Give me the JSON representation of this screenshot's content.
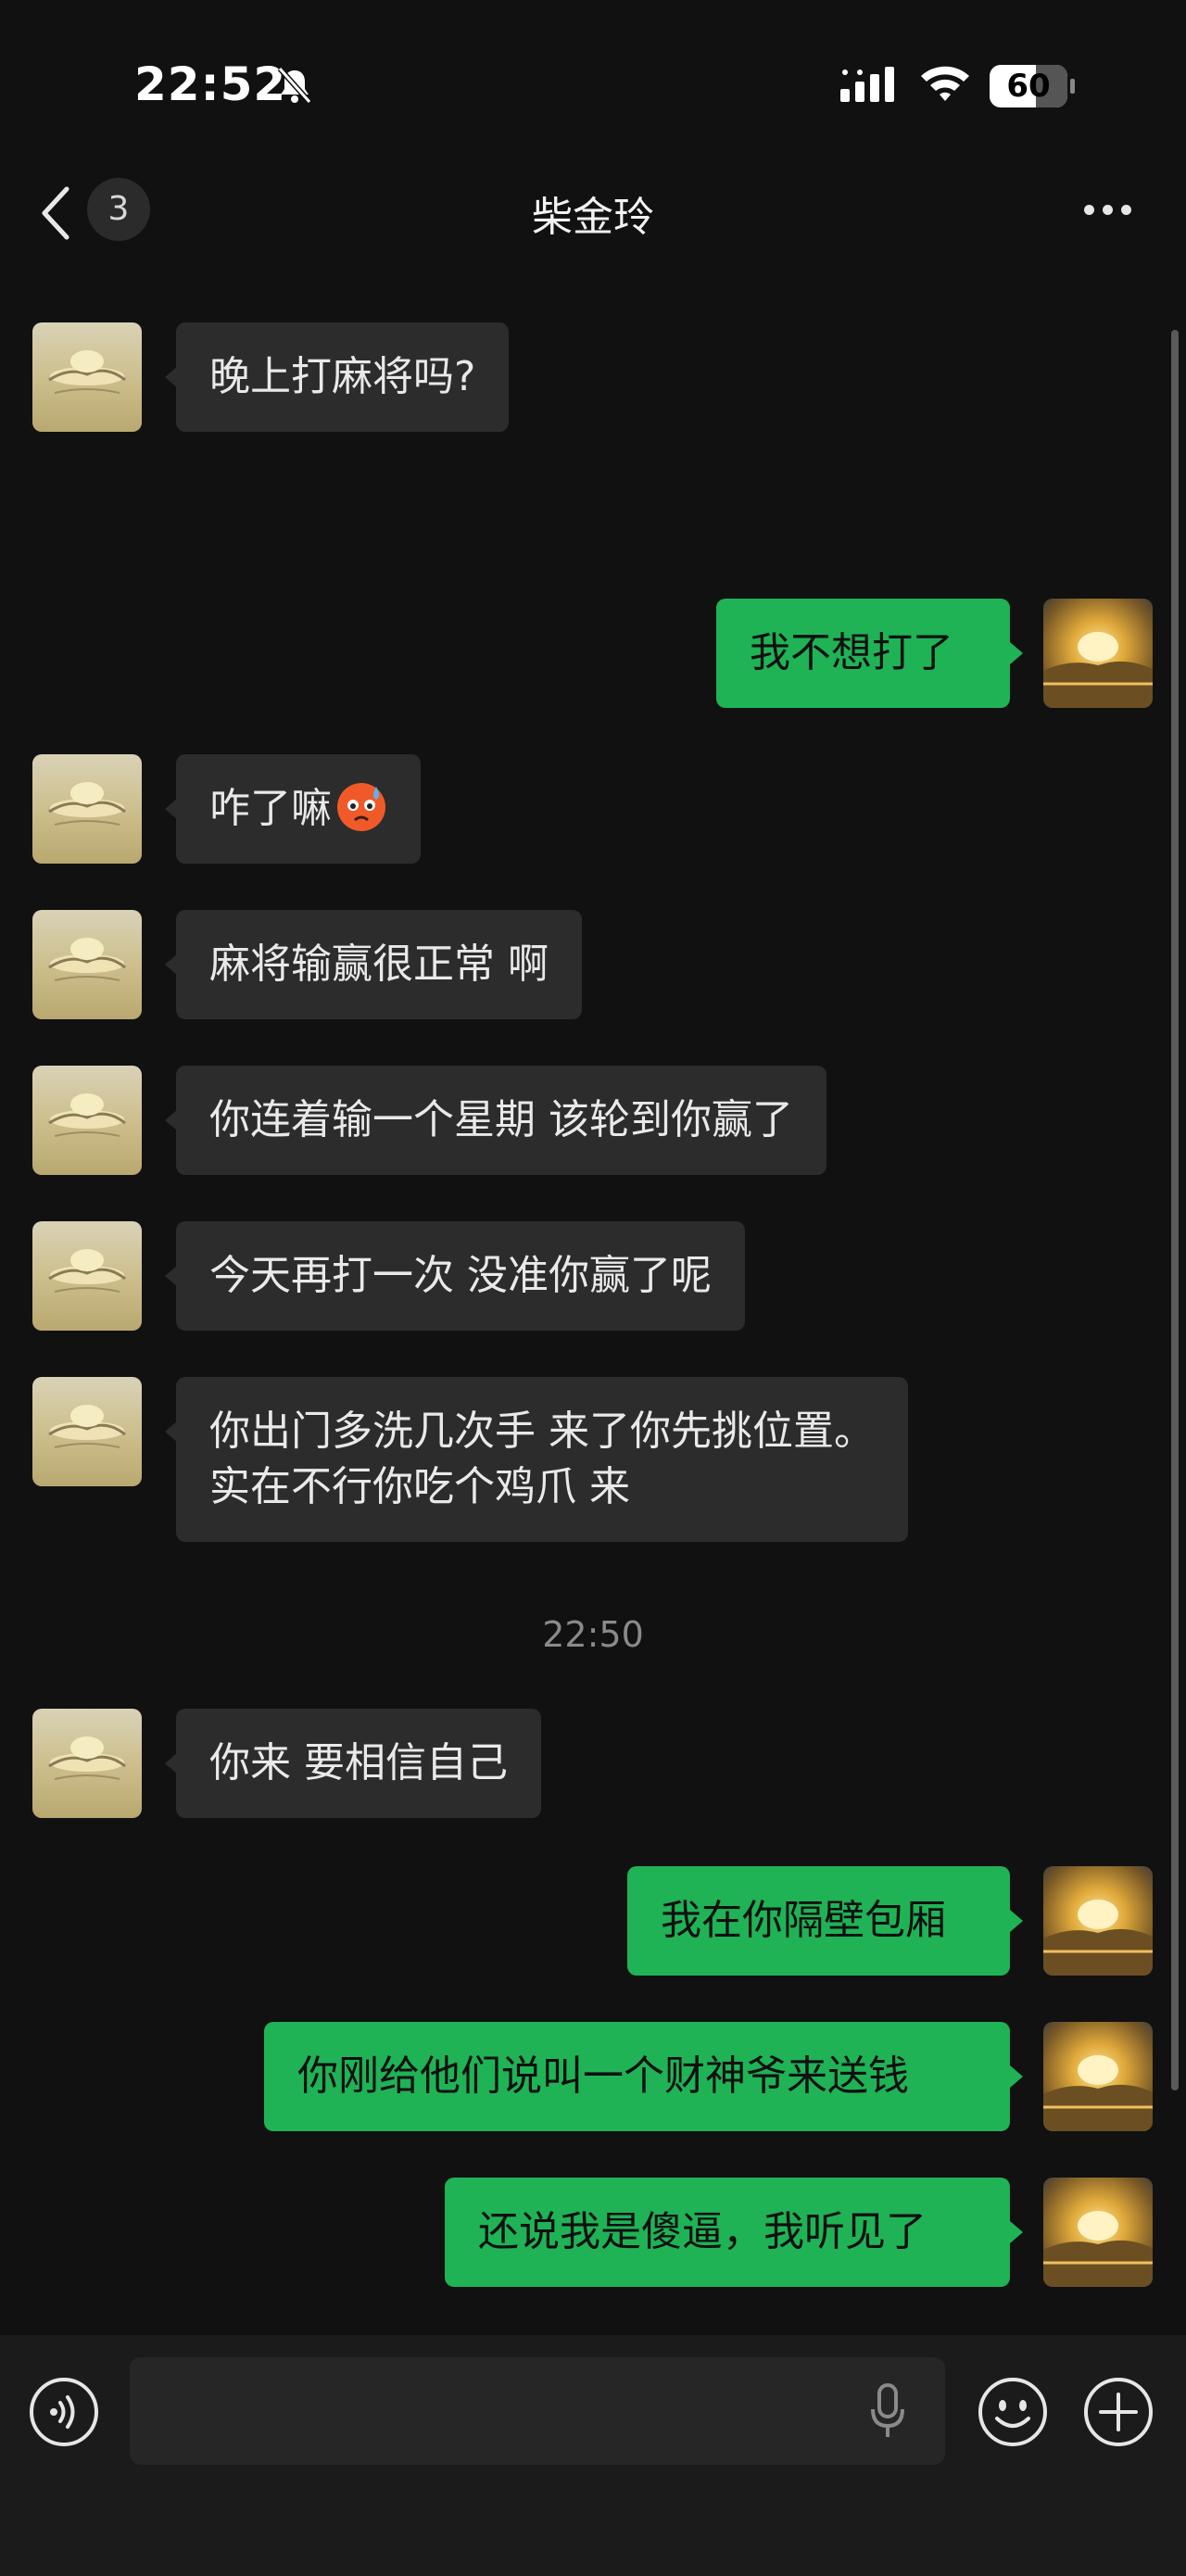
{
  "status_bar": {
    "time": "22:52",
    "battery_level": "60",
    "battery_fraction": 0.6
  },
  "header": {
    "back_unread_count": "3",
    "title": "柴金玲"
  },
  "messages": [
    {
      "side": "in",
      "lines": [
        "晚上打麻将吗?"
      ]
    },
    {
      "side": "out",
      "lines": [
        "我不想打了"
      ]
    },
    {
      "side": "in",
      "lines": [
        "咋了嘛"
      ],
      "emoji": "anxious-sweat-face"
    },
    {
      "side": "in",
      "lines": [
        "麻将输赢很正常 啊"
      ]
    },
    {
      "side": "in",
      "lines": [
        "你连着输一个星期 该轮到你赢了"
      ]
    },
    {
      "side": "in",
      "lines": [
        "今天再打一次 没准你赢了呢"
      ]
    },
    {
      "side": "in",
      "lines": [
        "你出门多洗几次手  来了你先挑位置。",
        "实在不行你吃个鸡爪 来"
      ]
    },
    {
      "side": "in",
      "lines": [
        "你来 要相信自己"
      ]
    },
    {
      "side": "out",
      "lines": [
        "我在你隔壁包厢"
      ]
    },
    {
      "side": "out",
      "lines": [
        "你刚给他们说叫一个财神爷来送钱"
      ]
    },
    {
      "side": "out",
      "lines": [
        "还说我是傻逼，我听见了"
      ]
    }
  ],
  "time_divider": "22:50",
  "input_bar": {
    "placeholder": ""
  },
  "colors": {
    "background": "#111111",
    "incoming_bubble": "#2c2c2c",
    "outgoing_bubble": "#1fb356",
    "input_bar": "#1b1b1b"
  },
  "icons": {
    "back": "chevron-left-icon",
    "more": "more-dots-icon",
    "voice": "voice-mode-icon",
    "mic": "microphone-icon",
    "emoji": "emoji-face-icon",
    "add": "plus-circle-icon"
  }
}
